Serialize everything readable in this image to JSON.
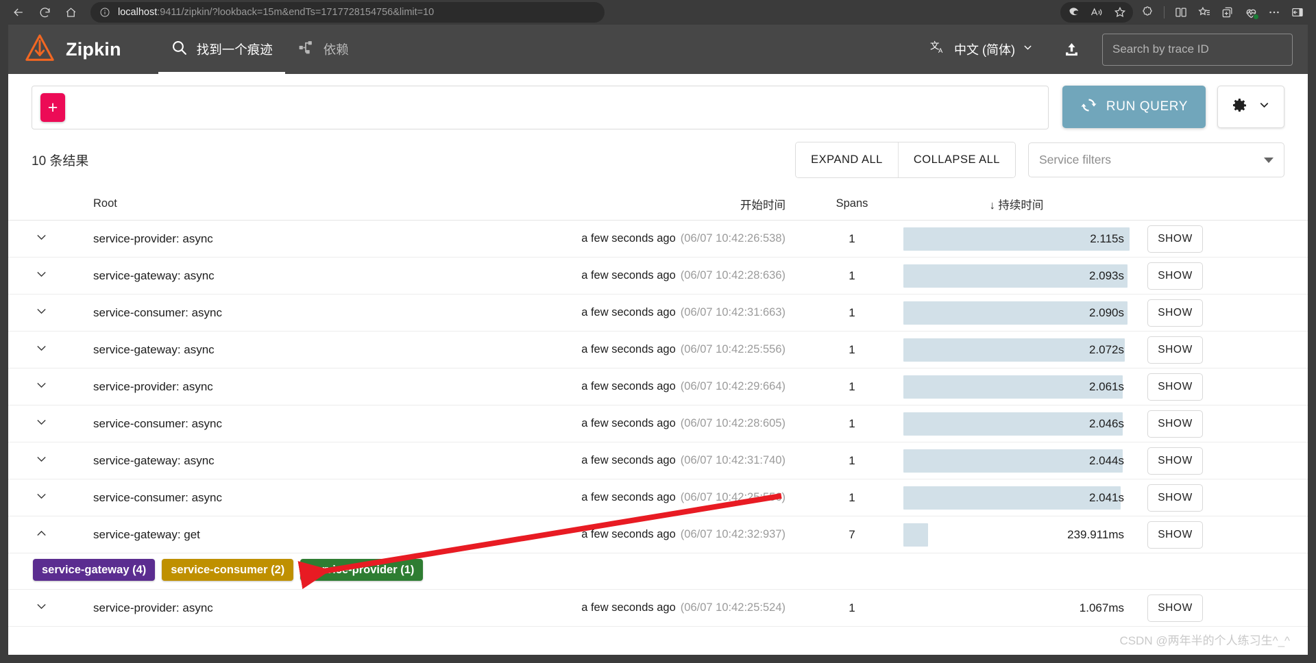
{
  "browser": {
    "url_host": "localhost",
    "url_rest": ":9411/zipkin/?lookback=15m&endTs=1717728154756&limit=10",
    "back_icon": "back-arrow-icon",
    "reload_icon": "reload-icon",
    "home_icon": "home-icon",
    "info_icon": "info-icon"
  },
  "appbar": {
    "brand": "Zipkin",
    "nav": [
      {
        "label": "找到一个痕迹",
        "icon": "search-icon",
        "active": true
      },
      {
        "label": "依赖",
        "icon": "dependency-tree-icon",
        "active": false
      }
    ],
    "language": "中文 (简体)",
    "trace_search_placeholder": "Search by trace ID"
  },
  "query": {
    "add_label": "+",
    "run_label": "RUN QUERY",
    "run_color": "#71a6bb"
  },
  "results": {
    "count_label": "10 条结果",
    "expand_all": "EXPAND ALL",
    "collapse_all": "COLLAPSE ALL",
    "service_filters_placeholder": "Service filters"
  },
  "table": {
    "headers": {
      "root": "Root",
      "start": "开始时间",
      "spans": "Spans",
      "duration": "↓ 持续时间"
    },
    "show_label": "SHOW",
    "rows": [
      {
        "root": "service-provider: async",
        "relative": "a few seconds ago",
        "timestamp": "(06/07 10:42:26:538)",
        "spans": "1",
        "duration": "2.115s",
        "bar_pct": 100,
        "expanded": false
      },
      {
        "root": "service-gateway: async",
        "relative": "a few seconds ago",
        "timestamp": "(06/07 10:42:28:636)",
        "spans": "1",
        "duration": "2.093s",
        "bar_pct": 99,
        "expanded": false
      },
      {
        "root": "service-consumer: async",
        "relative": "a few seconds ago",
        "timestamp": "(06/07 10:42:31:663)",
        "spans": "1",
        "duration": "2.090s",
        "bar_pct": 99,
        "expanded": false
      },
      {
        "root": "service-gateway: async",
        "relative": "a few seconds ago",
        "timestamp": "(06/07 10:42:25:556)",
        "spans": "1",
        "duration": "2.072s",
        "bar_pct": 98,
        "expanded": false
      },
      {
        "root": "service-provider: async",
        "relative": "a few seconds ago",
        "timestamp": "(06/07 10:42:29:664)",
        "spans": "1",
        "duration": "2.061s",
        "bar_pct": 97,
        "expanded": false
      },
      {
        "root": "service-consumer: async",
        "relative": "a few seconds ago",
        "timestamp": "(06/07 10:42:28:605)",
        "spans": "1",
        "duration": "2.046s",
        "bar_pct": 97,
        "expanded": false
      },
      {
        "root": "service-gateway: async",
        "relative": "a few seconds ago",
        "timestamp": "(06/07 10:42:31:740)",
        "spans": "1",
        "duration": "2.044s",
        "bar_pct": 97,
        "expanded": false
      },
      {
        "root": "service-consumer: async",
        "relative": "a few seconds ago",
        "timestamp": "(06/07 10:42:25:556)",
        "spans": "1",
        "duration": "2.041s",
        "bar_pct": 96,
        "expanded": false
      },
      {
        "root": "service-gateway: get",
        "relative": "a few seconds ago",
        "timestamp": "(06/07 10:42:32:937)",
        "spans": "7",
        "duration": "239.911ms",
        "bar_pct": 11,
        "expanded": true
      },
      {
        "root": "service-provider: async",
        "relative": "a few seconds ago",
        "timestamp": "(06/07 10:42:25:524)",
        "spans": "1",
        "duration": "1.067ms",
        "bar_pct": 0,
        "expanded": false
      }
    ],
    "expanded_badges": [
      {
        "label": "service-gateway (4)",
        "color": "#5b2d90"
      },
      {
        "label": "service-consumer (2)",
        "color": "#bf9000"
      },
      {
        "label": "service-provider (1)",
        "color": "#2e7d32"
      }
    ]
  },
  "annotation": {
    "arrow_color": "#e81b23"
  },
  "watermark": "CSDN @两年半的个人练习生^_^"
}
